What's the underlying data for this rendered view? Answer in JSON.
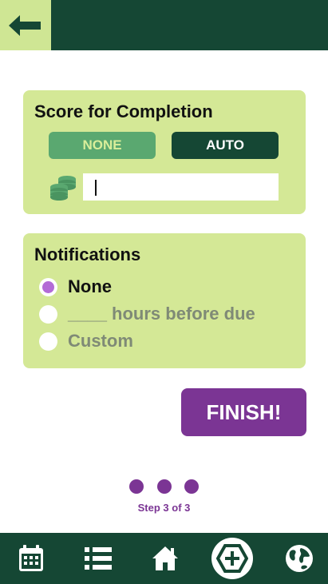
{
  "header": {
    "back_icon": "arrow-left-icon"
  },
  "score_card": {
    "title": "Score for Completion",
    "none_label": "NONE",
    "auto_label": "AUTO",
    "coins_icon": "coins-icon",
    "input_value": "",
    "input_placeholder": ""
  },
  "notifications_card": {
    "title": "Notifications",
    "options": [
      {
        "label": "None",
        "selected": true
      },
      {
        "label": "____ hours before due",
        "selected": false
      },
      {
        "label": "Custom",
        "selected": false
      }
    ]
  },
  "finish_label": "FINISH!",
  "progress": {
    "text": "Step 3 of 3",
    "current_step": 3,
    "total_steps": 3
  },
  "nav": {
    "items": [
      {
        "icon": "calendar-icon"
      },
      {
        "icon": "list-icon"
      },
      {
        "icon": "home-icon"
      },
      {
        "icon": "add-icon"
      },
      {
        "icon": "globe-icon"
      }
    ]
  },
  "colors": {
    "dark_green": "#154734",
    "light_green": "#d4e896",
    "purple": "#7b3594",
    "radio_selected": "#b36bd6"
  }
}
